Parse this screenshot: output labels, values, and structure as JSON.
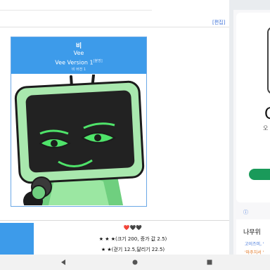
{
  "page": {
    "edit_link": "[편집]"
  },
  "infobox": {
    "title": "비",
    "subtitle": "Vee",
    "version": "Vee Version 1",
    "version_sup": "[불명]",
    "note": "비 버전 1",
    "header_color": "#3d9bea"
  },
  "stats": {
    "row1": "❤️🖤🖤",
    "row2": "★ ★ ★(크기 200, 증가 값 2.5)",
    "row3": "★ ★(걷기 12.5,달리기 22.5)"
  },
  "side": {
    "big_letter": "C",
    "sub_text": "오",
    "info_icon": "ⓘ",
    "wiki_title": "나무위",
    "wiki_line1": "고이즈미, '",
    "wiki_line2": "'마주치서 ' "
  },
  "nav": {
    "back": "◀",
    "home": "●",
    "recent": "■"
  }
}
